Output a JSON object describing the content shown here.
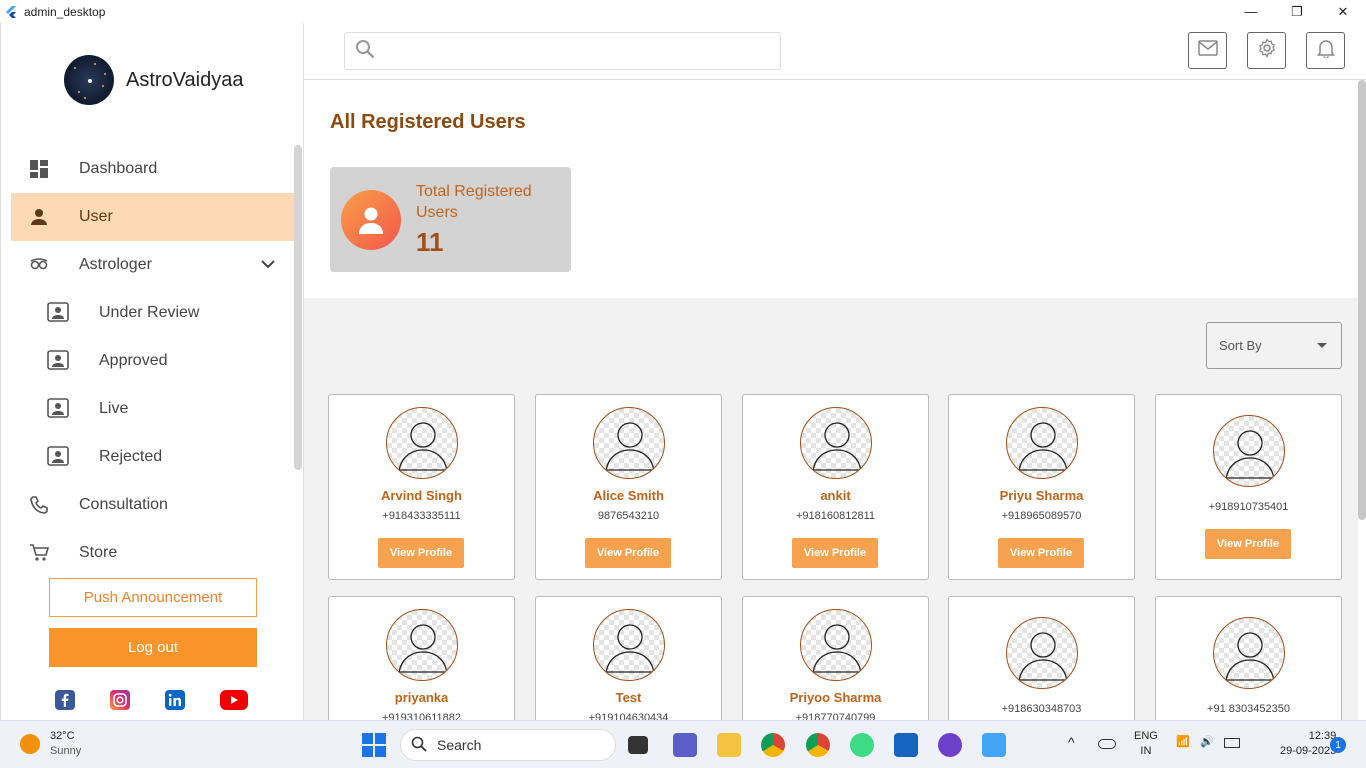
{
  "window": {
    "title": "admin_desktop",
    "minimize": "—",
    "maximize": "❐",
    "close": "✕"
  },
  "sidebar": {
    "brand": "AstroVaidyaa",
    "items": [
      {
        "label": "Dashboard",
        "icon": "dashboard-icon"
      },
      {
        "label": "User",
        "icon": "person-icon",
        "active": true
      },
      {
        "label": "Astrologer",
        "icon": "astrologer-icon"
      },
      {
        "label": "Under Review",
        "icon": "profile-card-icon"
      },
      {
        "label": "Approved",
        "icon": "profile-card-icon"
      },
      {
        "label": "Live",
        "icon": "profile-card-icon"
      },
      {
        "label": "Rejected",
        "icon": "profile-card-icon"
      },
      {
        "label": "Consultation",
        "icon": "phone-icon"
      },
      {
        "label": "Store",
        "icon": "cart-icon"
      }
    ],
    "push_label": "Push Announcement",
    "logout_label": "Log out",
    "social": [
      "facebook-icon",
      "instagram-icon",
      "linkedin-icon",
      "youtube-icon"
    ]
  },
  "topbar": {
    "search_placeholder": "",
    "icons": [
      "mail-icon",
      "settings-icon",
      "bell-icon"
    ]
  },
  "header": {
    "title": "All Registered Users",
    "stat_label": "Total Registered Users",
    "stat_value": "11"
  },
  "sort": {
    "label": "Sort By"
  },
  "view_label": "View Profile",
  "users": [
    {
      "name": "Arvind Singh",
      "phone": "+918433335111"
    },
    {
      "name": "Alice Smith",
      "phone": "9876543210"
    },
    {
      "name": "ankit",
      "phone": "+918160812811"
    },
    {
      "name": "Priyu Sharma",
      "phone": "+918965089570"
    },
    {
      "name": "",
      "phone": "+918910735401"
    },
    {
      "name": "priyanka",
      "phone": "+919310611882"
    },
    {
      "name": "Test",
      "phone": "+919104630434"
    },
    {
      "name": "Priyoo Sharma",
      "phone": "+918770740799"
    },
    {
      "name": "",
      "phone": "+918630348703"
    },
    {
      "name": "",
      "phone": "+91 8303452350"
    }
  ],
  "taskbar": {
    "temp": "32°C",
    "condition": "Sunny",
    "search_label": "Search",
    "lang": "ENG",
    "region": "IN",
    "time": "12:39",
    "date": "29-09-2023",
    "notif_count": "1",
    "colors": {
      "accent": "#f9952b",
      "active_bg": "#fdd9b5",
      "title": "#8a4a10"
    }
  }
}
